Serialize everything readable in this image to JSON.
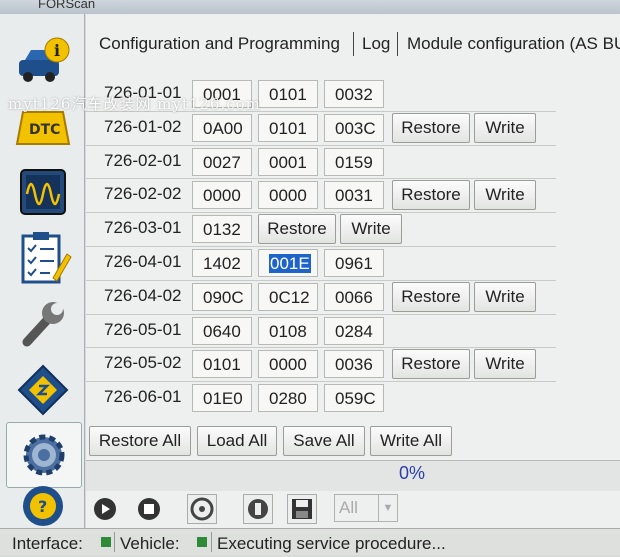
{
  "window": {
    "title": "FORScan"
  },
  "tabs": [
    {
      "label": "Configuration and Programming"
    },
    {
      "label": "Log"
    },
    {
      "label": "Module configuration (AS BU"
    }
  ],
  "sidebar": {
    "items": [
      {
        "icon": "vehicle-info-icon"
      },
      {
        "icon": "dtc-icon"
      },
      {
        "icon": "oscilloscope-icon"
      },
      {
        "icon": "checklist-icon"
      },
      {
        "icon": "wrench-icon"
      },
      {
        "icon": "chip-icon"
      },
      {
        "icon": "gear-icon"
      },
      {
        "icon": "help-icon"
      }
    ]
  },
  "config_rows": [
    {
      "id": "726-01-01",
      "values": [
        "0001",
        "0101",
        "0032"
      ],
      "restore": false
    },
    {
      "id": "726-01-02",
      "values": [
        "0A00",
        "0101",
        "003C"
      ],
      "restore": true
    },
    {
      "id": "726-02-01",
      "values": [
        "0027",
        "0001",
        "0159"
      ],
      "restore": false
    },
    {
      "id": "726-02-02",
      "values": [
        "0000",
        "0000",
        "0031"
      ],
      "restore": true
    },
    {
      "id": "726-03-01",
      "values": [
        "0132"
      ],
      "restore": true
    },
    {
      "id": "726-04-01",
      "values": [
        "1402",
        "001E",
        "0961"
      ],
      "restore": false,
      "selected_cell": 1
    },
    {
      "id": "726-04-02",
      "values": [
        "090C",
        "0C12",
        "0066"
      ],
      "restore": true
    },
    {
      "id": "726-05-01",
      "values": [
        "0640",
        "0108",
        "0284"
      ],
      "restore": false
    },
    {
      "id": "726-05-02",
      "values": [
        "0101",
        "0000",
        "0036"
      ],
      "restore": true
    },
    {
      "id": "726-06-01",
      "values": [
        "01E0",
        "0280",
        "059C"
      ],
      "restore": false
    }
  ],
  "row_buttons": {
    "restore_label": "Restore",
    "write_label": "Write"
  },
  "bottom_buttons": {
    "restore_all": "Restore All",
    "load_all": "Load All",
    "save_all": "Save All",
    "write_all": "Write All"
  },
  "progress": {
    "percent": 0,
    "text": "0%"
  },
  "toolbar": {
    "items": [
      "play-icon",
      "stop-icon",
      "connect-icon",
      "disconnect-icon",
      "save-icon"
    ],
    "combo_value": "All"
  },
  "status": {
    "interface_label": "Interface:",
    "vehicle_label": "Vehicle:",
    "message": "Executing service procedure..."
  },
  "watermark": "myt126汽车改装网   myt126.com",
  "colors": {
    "selection": "#1e63c8",
    "led": "#2e8b3a",
    "progress_text": "#2a3fa8"
  }
}
